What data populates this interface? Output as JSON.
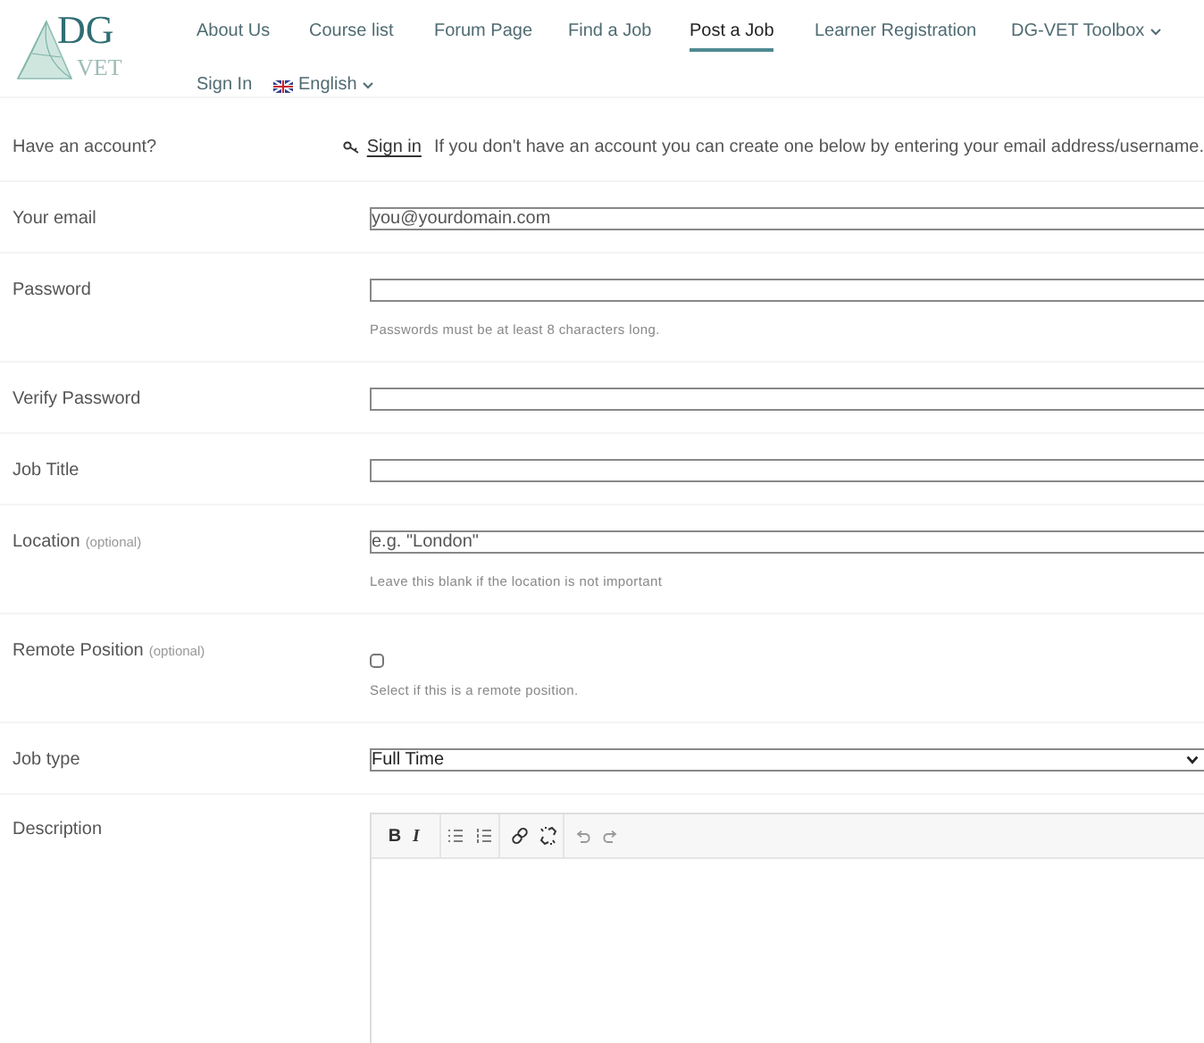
{
  "logo": {
    "top": "DG",
    "bottom": "VET"
  },
  "nav": [
    {
      "label": "About Us",
      "selected": false
    },
    {
      "label": "Course list",
      "selected": false
    },
    {
      "label": "Forum Page",
      "selected": false
    },
    {
      "label": "Find a Job",
      "selected": false
    },
    {
      "label": "Post a Job",
      "selected": true
    },
    {
      "label": "Learner Registration",
      "selected": false
    },
    {
      "label": "DG-VET Toolbox",
      "selected": false,
      "dropdown": true
    },
    {
      "label": "Sign In",
      "selected": false
    },
    {
      "label": "English",
      "selected": false,
      "dropdown": true,
      "flag": true
    }
  ],
  "form": [
    {
      "kind": "note",
      "label": "Have an account?",
      "link": "Sign in",
      "text": "If you don't have an account you can create one below by entering your email address/username."
    },
    {
      "kind": "text",
      "label": "Your email",
      "placeholder": "you@yourdomain.com"
    },
    {
      "kind": "text",
      "label": "Password",
      "hint": "Passwords must be at least 8 characters long."
    },
    {
      "kind": "text",
      "label": "Verify Password"
    },
    {
      "kind": "text",
      "label": "Job Title"
    },
    {
      "kind": "text",
      "label": "Location",
      "optional": "(optional)",
      "placeholder": "e.g. \"London\"",
      "hint": "Leave this blank if the location is not important"
    },
    {
      "kind": "checkbox",
      "label": "Remote Position",
      "optional": "(optional)",
      "checked": false,
      "hint": "Select if this is a remote position."
    },
    {
      "kind": "select",
      "label": "Job type",
      "value": "Full Time"
    },
    {
      "kind": "editor",
      "label": "Description",
      "toolbar": [
        "B",
        "I"
      ]
    }
  ]
}
